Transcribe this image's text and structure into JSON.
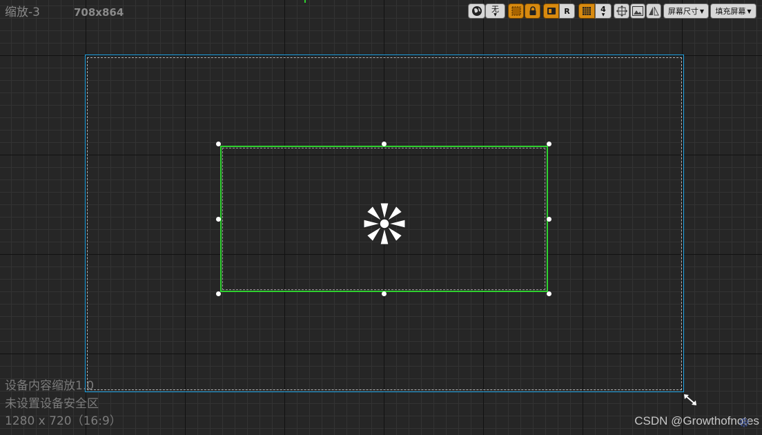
{
  "hud": {
    "zoom": "缩放-3",
    "resolution": "708x864"
  },
  "toolbar": {
    "none_label": "无",
    "r_label": "R",
    "grid_count": "4",
    "screen_size_label": "屏幕尺寸",
    "fill_screen_label": "填充屏幕"
  },
  "info": {
    "line1": "设备内容缩放1.0",
    "line2": "未设置设备安全区",
    "line3": "1280 x 720（16:9）"
  },
  "watermark": "CSDN @Growthofnotes",
  "colors": {
    "background": "#262626",
    "outer_frame": "#1fa6e8",
    "selection": "#2fd12f",
    "toolbar_active": "#d88a0f"
  }
}
